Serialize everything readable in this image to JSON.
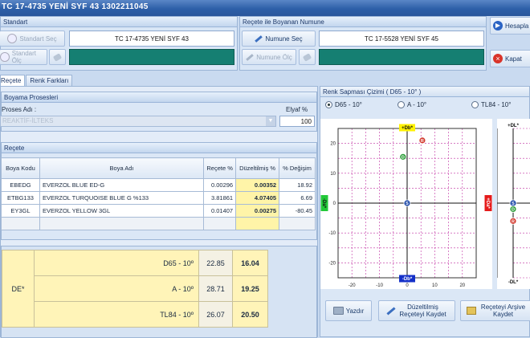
{
  "window": {
    "title": "TC 17-4735  YENİ SYF 43 1302211045"
  },
  "standart": {
    "header": "Standart",
    "select_label": "Standart Seç",
    "measure_label": "Standart Ölç",
    "value": "TC 17-4735  YENİ SYF 43",
    "color": "#157f72"
  },
  "numune": {
    "header": "Reçete ile Boyanan Numune",
    "select_label": "Numune Seç",
    "measure_label": "Numune Ölç",
    "value": "TC 17-5528  YENİ SYF 45",
    "color": "#157f72"
  },
  "actions": {
    "calculate": "Hesapla",
    "close": "Kapat"
  },
  "tabs": [
    {
      "label": "Reçete",
      "active": true
    },
    {
      "label": "Renk Farkları",
      "active": false
    }
  ],
  "process": {
    "header": "Boyama Prosesleri",
    "name_label": "Proses Adı :",
    "name_value": "REAKTİF-İLTEKS",
    "bath_label": "Elyaf %",
    "bath_value": "100"
  },
  "recipe": {
    "header": "Reçete",
    "columns": [
      "Boya Kodu",
      "Boya Adı",
      "Reçete %",
      "Düzeltilmiş %",
      "% Değişim"
    ],
    "rows": [
      {
        "code": "EBEDG",
        "name": "EVERZOL BLUE ED-G",
        "recipe": "0.00296",
        "corrected": "0.00352",
        "change": "18.92"
      },
      {
        "code": "ETBG133",
        "name": "EVERZOL TURQUOISE BLUE G %133",
        "recipe": "3.81861",
        "corrected": "4.07405",
        "change": "6.69"
      },
      {
        "code": "EY3GL",
        "name": "EVERZOL YELLOW 3GL",
        "recipe": "0.01407",
        "corrected": "0.00275",
        "change": "-80.45"
      }
    ]
  },
  "de": {
    "label": "DE*",
    "rows": [
      {
        "illuminant": "D65 - 10º",
        "before": "22.85",
        "after": "16.04"
      },
      {
        "illuminant": "A - 10º",
        "before": "28.71",
        "after": "19.25"
      },
      {
        "illuminant": "TL84 - 10º",
        "before": "26.07",
        "after": "20.50"
      }
    ]
  },
  "chart_panel": {
    "header": "Renk Sapması Çizimi ( D65 - 10° )",
    "radios": [
      {
        "label": "D65 - 10°",
        "checked": true
      },
      {
        "label": "A - 10°",
        "checked": false
      },
      {
        "label": "TL84 - 10°",
        "checked": false
      }
    ]
  },
  "chart_data": [
    {
      "type": "scatter",
      "axes": {
        "top": "+Db*",
        "bottom": "-Db*",
        "left": "-Da*",
        "right": "+Da*"
      },
      "xlim": [
        -25,
        25
      ],
      "ylim": [
        -25,
        25
      ],
      "xticks": [
        -20,
        -10,
        0,
        10,
        20
      ],
      "yticks": [
        20,
        10,
        0,
        -10,
        -20
      ],
      "grid": true,
      "points": [
        {
          "label": "R",
          "x": 5.5,
          "y": 21,
          "color": "#d23a2f"
        },
        {
          "label": "D",
          "x": -1.5,
          "y": 15.5,
          "color": "#2f9e3c"
        },
        {
          "label": "S",
          "x": 0,
          "y": 0,
          "color": "#1f4aa8"
        }
      ]
    },
    {
      "type": "scatter",
      "axes": {
        "top": "+DL*",
        "bottom": "-DL*"
      },
      "points": [
        {
          "label": "S",
          "y": 0,
          "color": "#1f4aa8"
        },
        {
          "label": "D",
          "y": -2,
          "color": "#2f9e3c"
        },
        {
          "label": "R",
          "y": -6,
          "color": "#d23a2f"
        }
      ]
    }
  ],
  "bottom_buttons": {
    "print": "Yazdır",
    "save_corrected": "Düzeltilmiş Reçeteyi Kaydet",
    "save_archive": "Reçeteyi Arşive Kaydet"
  }
}
